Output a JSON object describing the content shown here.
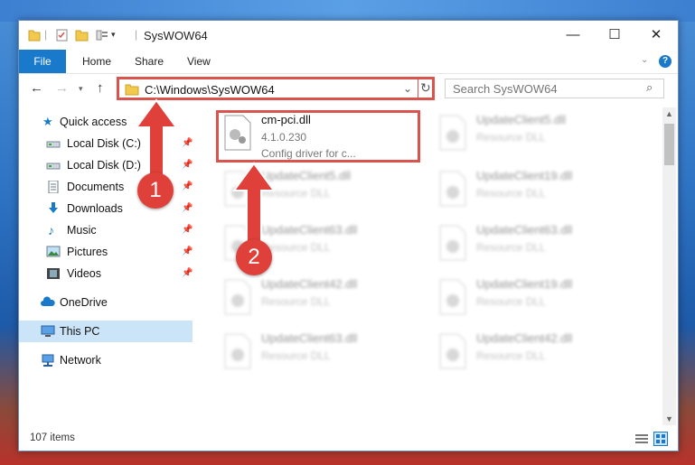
{
  "window": {
    "title": "SysWOW64",
    "minimize": "—",
    "maximize": "☐",
    "close": "✕"
  },
  "ribbon": {
    "tabs": [
      "File",
      "Home",
      "Share",
      "View"
    ],
    "help": "?"
  },
  "address": {
    "path": "C:\\Windows\\SysWOW64",
    "search_placeholder": "Search SysWOW64"
  },
  "sidebar": {
    "items": [
      {
        "label": "Quick access",
        "icon": "star-icon",
        "pinned": false
      },
      {
        "label": "Local Disk (C:)",
        "icon": "drive-icon",
        "pinned": true
      },
      {
        "label": "Local Disk (D:)",
        "icon": "drive-icon",
        "pinned": true
      },
      {
        "label": "Documents",
        "icon": "document-icon",
        "pinned": true
      },
      {
        "label": "Downloads",
        "icon": "download-icon",
        "pinned": true
      },
      {
        "label": "Music",
        "icon": "music-icon",
        "pinned": true
      },
      {
        "label": "Pictures",
        "icon": "pictures-icon",
        "pinned": true
      },
      {
        "label": "Videos",
        "icon": "video-icon",
        "pinned": true
      },
      {
        "label": "OneDrive",
        "icon": "cloud-icon",
        "pinned": false
      },
      {
        "label": "This PC",
        "icon": "computer-icon",
        "pinned": false
      },
      {
        "label": "Network",
        "icon": "network-icon",
        "pinned": false
      }
    ]
  },
  "files": {
    "highlighted": {
      "name": "cm-pci.dll",
      "version": "4.1.0.230",
      "description": "Config driver for c..."
    },
    "blurred": [
      {
        "name": "UpdateClient5.dll",
        "type": "Resource DLL"
      },
      {
        "name": "UpdateClient5.dll",
        "type": "Resource DLL"
      },
      {
        "name": "UpdateClient19.dll",
        "type": "Resource DLL"
      },
      {
        "name": "UpdateClient63.dll",
        "type": "Resource DLL"
      },
      {
        "name": "UpdateClient63.dll",
        "type": "Resource DLL"
      },
      {
        "name": "UpdateClient42.dll",
        "type": "Resource DLL"
      },
      {
        "name": "UpdateClient19.dll",
        "type": "Resource DLL"
      },
      {
        "name": "UpdateClient63.dll",
        "type": "Resource DLL"
      },
      {
        "name": "UpdateClient42.dll",
        "type": "Resource DLL"
      }
    ]
  },
  "status": {
    "item_count": "107 items"
  },
  "annotations": {
    "step1": "1",
    "step2": "2"
  },
  "colors": {
    "accent": "#1979ca",
    "highlight": "#d9534f",
    "selected": "#cce4f7"
  }
}
